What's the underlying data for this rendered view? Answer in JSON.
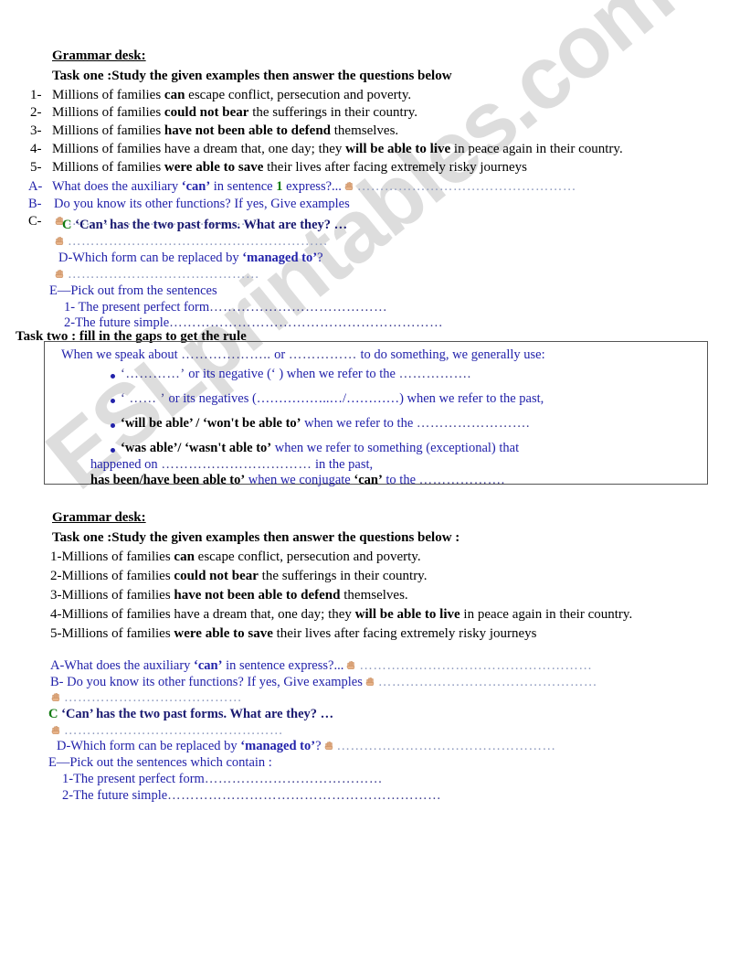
{
  "watermark": {
    "text": "ESLprintables.com"
  },
  "section1": {
    "heading": "Grammar desk:",
    "task_one": "Task one :Study the given examples then answer the questions below",
    "examples": [
      {
        "num": "1-",
        "pre": "Millions of families ",
        "bold": "can",
        "post": " escape conflict, persecution and poverty."
      },
      {
        "num": "2-",
        "pre": "Millions of families ",
        "bold": "could not bear",
        "post": " the sufferings in their country."
      },
      {
        "num": "3-",
        "pre": "Millions of families ",
        "bold": "have not been able to defend",
        "post": " themselves."
      },
      {
        "num": "4-",
        "pre": "Millions of families have a dream that, one day; they ",
        "bold": "will be able to live",
        "post": " in peace again in their country."
      },
      {
        "num": "5-",
        "pre": "Millions of families ",
        "bold": "were able to save",
        "post": " their lives after facing extremely risky journeys"
      }
    ],
    "qa": {
      "a_label": "A-",
      "a_text_1": "What does the auxiliary ",
      "a_can": "‘can’",
      "a_text_2": " in sentence ",
      "a_num": "1",
      "a_text_3": " express?...",
      "a_dots": "…………………………………………",
      "b_label": "B-",
      "b_text": "Do you know its other functions? If yes, Give examples",
      "c_label": "C-",
      "c_dots": "……………………………………",
      "c_letter": "C",
      "c_text": "‘Can’ has the two past forms. What are they? …",
      "c_dots2": "…………………………………………………",
      "d_text_1": "D-Which form can be replaced by ",
      "d_bold": "‘managed to’",
      "d_text_2": "?",
      "d_dots": "……………………………………",
      "e_text": "E—Pick out from the sentences",
      "e1_text": "1- The present perfect form",
      "e1_dots": "…………………………………",
      "e2_text": "2-The future simple",
      "e2_dots": "……………………………………………………"
    }
  },
  "task_two": {
    "heading": "Task two : fill in the gaps to get the rule",
    "intro_1": "When we speak about ",
    "intro_dots1": "………………..",
    "intro_2": " or ",
    "intro_dots2": "……………",
    "intro_3": " to do something, we generally use:",
    "bullets": [
      {
        "quote": "‘…………’",
        "mid": " or its negative (‘          ) when we refer to the ",
        "dots": "……………."
      },
      {
        "quote": "‘ …… ’",
        "mid": " or its negatives (……………..…/…………) when we refer to the past,",
        "dots": ""
      },
      {
        "quote": "‘will be able’ / ‘won't be able to’",
        "mid": " when we refer to the ",
        "dots": "……………………."
      },
      {
        "quote": "‘was able’/ ‘wasn't able to’",
        "mid": " when we refer to something (exceptional) that",
        "dots": ""
      }
    ],
    "line_happened_1": "happened on ",
    "line_happened_dots": "……………………………",
    "line_happened_2": " in the past,",
    "line_has_been_bold": "has been/have been able to’",
    "line_has_been_rest": " when we conjugate ",
    "line_has_been_can": "‘can’",
    "line_has_been_tail": " to the ",
    "line_has_been_dots": "………………."
  },
  "section2": {
    "heading": "Grammar desk:",
    "task_one": "Task one :Study the given examples then answer the questions below :",
    "examples": [
      {
        "pre": "1-Millions of families ",
        "bold": "can",
        "post": " escape conflict, persecution and poverty."
      },
      {
        "pre": "2-Millions of families ",
        "bold": "could not bear",
        "post": " the sufferings in their country."
      },
      {
        "pre": "3-Millions of families ",
        "bold": "have not been able to defend",
        "post": " themselves."
      },
      {
        "pre": "4-Millions of families have a dream that, one day; they ",
        "bold": "will be able to live",
        "post": " in peace again in their country."
      },
      {
        "pre": "5-Millions of families ",
        "bold": "were able to save",
        "post": " their lives after facing extremely risky journeys"
      }
    ],
    "qa": {
      "a_text_1": "A-What does the auxiliary ",
      "a_can": "‘can’",
      "a_text_2": " in sentence express?...",
      "a_dots": "……………………………………………",
      "b_text": "B- Do you know its other functions? If yes, Give examples",
      "b_dots": "…………………………………………",
      "b_dots2": "…………………………………",
      "c_letter": "C",
      "c_text": "‘Can’ has the two past forms. What are they? …",
      "c_dots": "…………………………………………",
      "d_text_1": "D-Which form can be replaced by ",
      "d_bold": "‘managed to’",
      "d_text_2": "?",
      "d_dots": "…………………………………………",
      "e_text": "E—Pick out the sentences which contain :",
      "e1_text": "1-The present perfect form",
      "e1_dots": "…………………………………",
      "e2_text": "2-The future simple",
      "e2_dots": "……………………………………………………"
    }
  },
  "icons": {
    "hand": "pointing-hand-icon"
  }
}
